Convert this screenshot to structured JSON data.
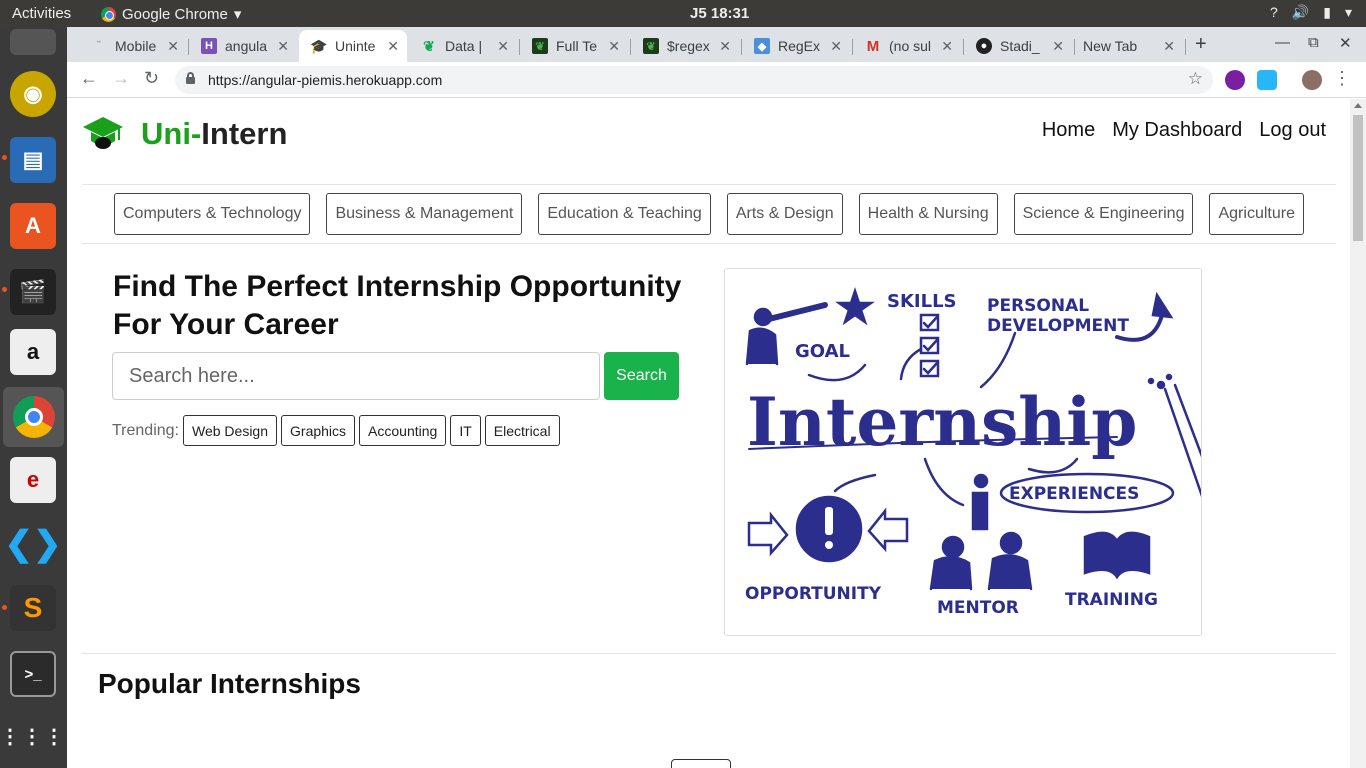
{
  "system": {
    "activities": "Activities",
    "app_name": "Google Chrome",
    "clock": "J5 18:31"
  },
  "tabs": [
    {
      "title": "Mobile",
      "active": false
    },
    {
      "title": "angula",
      "active": false
    },
    {
      "title": "Uninte",
      "active": true
    },
    {
      "title": "Data |",
      "active": false
    },
    {
      "title": "Full Te",
      "active": false
    },
    {
      "title": "$regex",
      "active": false
    },
    {
      "title": "RegEx",
      "active": false
    },
    {
      "title": "(no sul",
      "active": false
    },
    {
      "title": "Stadi_",
      "active": false
    },
    {
      "title": "New Tab",
      "active": false
    }
  ],
  "address_bar": {
    "url": "https://angular-piemis.herokuapp.com"
  },
  "site": {
    "brand_uni": "Uni-",
    "brand_intern": "Intern",
    "nav": [
      "Home",
      "My Dashboard",
      "Log out"
    ],
    "categories": [
      "Computers & Technology",
      "Business & Management",
      "Education & Teaching",
      "Arts & Design",
      "Health & Nursing",
      "Science & Engineering",
      "Agriculture"
    ],
    "hero_title": "Find The Perfect Internship Opportunity For Your Career",
    "search_placeholder": "Search here...",
    "search_button": "Search",
    "trending_label": "Trending:",
    "trending": [
      "Web Design",
      "Graphics",
      "Accounting",
      "IT",
      "Electrical"
    ],
    "illustration": {
      "main_word": "Internship",
      "words": [
        "GOAL",
        "SKILLS",
        "PERSONAL",
        "DEVELOPMENT",
        "EXPERIENCES",
        "OPPORTUNITY",
        "MENTOR",
        "TRAINING"
      ]
    },
    "popular_title": "Popular Internships"
  },
  "colors": {
    "brand_green": "#1aa01a",
    "search_green": "#19b24b",
    "illustration_ink": "#2b2e8c"
  }
}
